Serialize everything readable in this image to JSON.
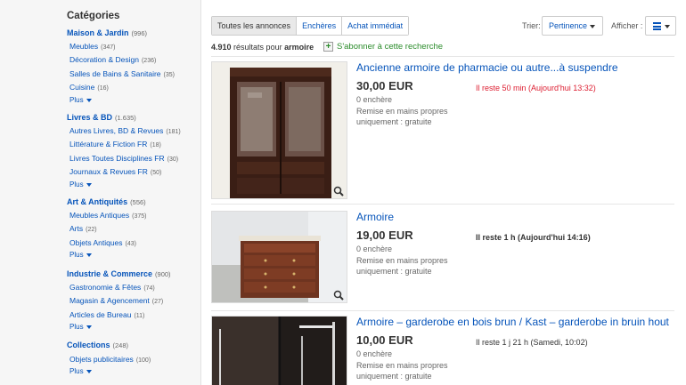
{
  "sidebar": {
    "title": "Catégories",
    "categories": [
      {
        "name": "Maison & Jardin",
        "count": "(996)",
        "subs": [
          {
            "name": "Meubles",
            "count": "(347)"
          },
          {
            "name": "Décoration & Design",
            "count": "(236)"
          },
          {
            "name": "Salles de Bains & Sanitaire",
            "count": "(35)"
          },
          {
            "name": "Cuisine",
            "count": "(16)"
          }
        ],
        "more": "Plus"
      },
      {
        "name": "Livres & BD",
        "count": "(1.635)",
        "subs": [
          {
            "name": "Autres Livres, BD & Revues",
            "count": "(181)"
          },
          {
            "name": "Littérature & Fiction FR",
            "count": "(18)"
          },
          {
            "name": "Livres Toutes Disciplines FR",
            "count": "(30)"
          },
          {
            "name": "Journaux & Revues FR",
            "count": "(50)"
          }
        ],
        "more": "Plus"
      },
      {
        "name": "Art & Antiquités",
        "count": "(556)",
        "subs": [
          {
            "name": "Meubles Antiques",
            "count": "(375)"
          },
          {
            "name": "Arts",
            "count": "(22)"
          },
          {
            "name": "Objets Antiques",
            "count": "(43)"
          }
        ],
        "more": "Plus"
      },
      {
        "name": "Industrie & Commerce",
        "count": "(900)",
        "subs": [
          {
            "name": "Gastronomie & Fêtes",
            "count": "(74)"
          },
          {
            "name": "Magasin & Agencement",
            "count": "(27)"
          },
          {
            "name": "Articles de Bureau",
            "count": "(11)"
          }
        ],
        "more": "Plus"
      },
      {
        "name": "Collections",
        "count": "(248)",
        "subs": [
          {
            "name": "Objets publicitaires",
            "count": "(100)"
          }
        ],
        "more": "Plus"
      }
    ]
  },
  "toolbar": {
    "tabs": [
      "Toutes les annonces",
      "Enchères",
      "Achat immédiat"
    ],
    "sort_label": "Trier:",
    "sort_value": "Pertinence",
    "show_label": "Afficher :",
    "view_icon": "list-view-icon"
  },
  "results": {
    "count": "4.910",
    "text": "résultats pour",
    "query": "armoire",
    "subscribe": "S'abonner à cette recherche"
  },
  "listings": [
    {
      "title": "Ancienne armoire de pharmacie ou autre...à suspendre",
      "price": "30,00 EUR",
      "bids": "0 enchère",
      "shipping": "Remise en mains propres uniquement : gratuite",
      "time": "Il reste 50 min (Aujourd'hui 13:32)",
      "time_color": "#dd1e31"
    },
    {
      "title": "Armoire",
      "price": "19,00 EUR",
      "bids": "0 enchère",
      "shipping": "Remise en mains propres uniquement : gratuite",
      "time_bold": "Il reste 1 h",
      "time": "(Aujourd'hui 14:16)",
      "time_color": "#333333"
    },
    {
      "title": "Armoire – garderobe en bois brun / Kast – garderobe in bruin hout",
      "price": "10,00 EUR",
      "bids": "0 enchère",
      "shipping": "Remise en mains propres uniquement : gratuite",
      "time": "Il reste 1 j 21 h (Samedi, 10:02)",
      "time_color": "#333333"
    }
  ],
  "colors": {
    "link": "#0654ba",
    "urgent": "#dd1e31",
    "subscribe": "#2a8b2a"
  }
}
